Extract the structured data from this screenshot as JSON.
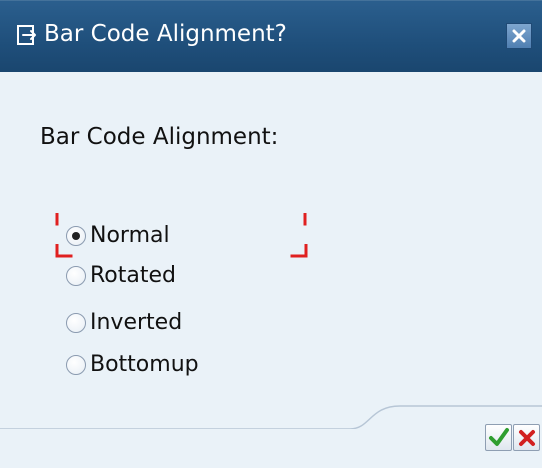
{
  "window": {
    "title": "Bar Code Alignment?",
    "close_icon": "close-icon",
    "title_icon": "dialog-icon"
  },
  "prompt": {
    "label": "Bar Code Alignment:"
  },
  "alignment_options": [
    {
      "label": "Normal",
      "selected": true
    },
    {
      "label": "Rotated",
      "selected": false
    },
    {
      "label": "Inverted",
      "selected": false
    },
    {
      "label": "Bottomup",
      "selected": false
    }
  ],
  "footer": {
    "confirm_icon": "checkmark-icon",
    "cancel_icon": "cancel-icon"
  },
  "colors": {
    "titlebar": "#1f4f7b",
    "background": "#eaf2f8",
    "focus_marker": "#e02020",
    "confirm": "#2f9e2f",
    "cancel": "#d22020"
  }
}
